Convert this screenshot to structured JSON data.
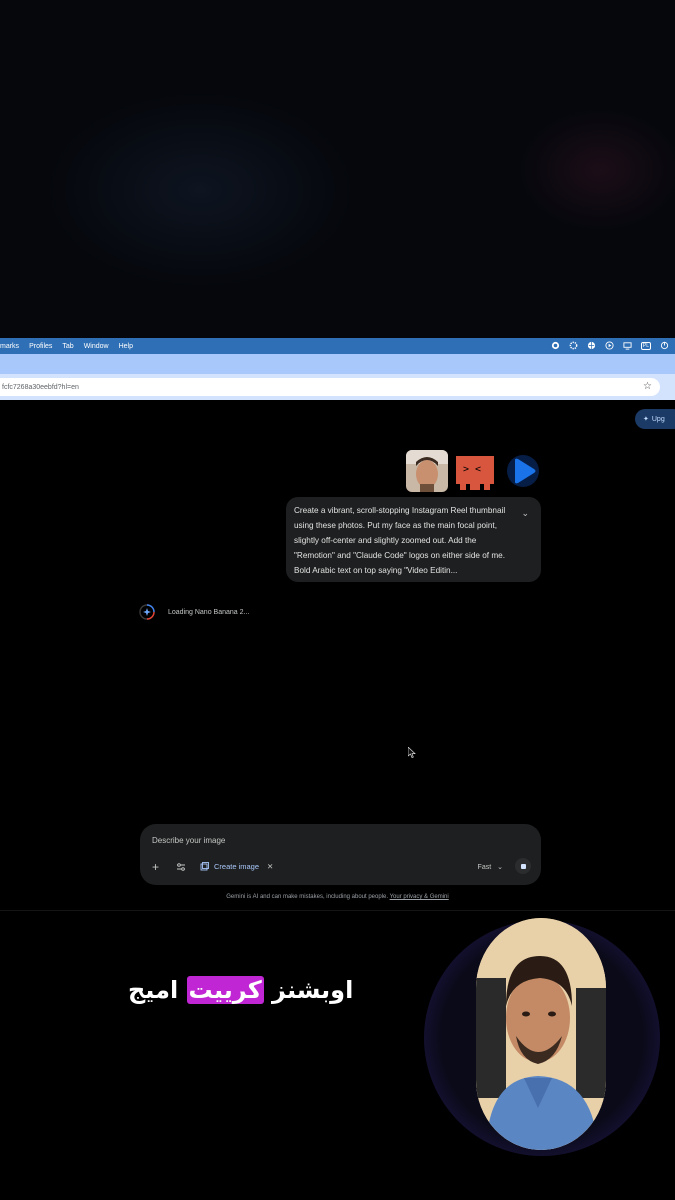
{
  "menubar": {
    "items": [
      "marks",
      "Profiles",
      "Tab",
      "Window",
      "Help"
    ],
    "status_icons": [
      "record-icon",
      "gear-icon",
      "globe-icon",
      "play-icon",
      "display-icon",
      "keyboard-layout-icon",
      "power-icon"
    ],
    "layout_badge": "PL"
  },
  "browser": {
    "url": "fcfc7268a30eebfd?hl=en"
  },
  "gemini": {
    "upgrade_label": "Upg",
    "prompt_text": "Create a vibrant, scroll-stopping Instagram Reel thumbnail using these photos. Put my face as the main focal point, slightly off-center and slightly zoomed out. Add the \"Remotion\" and \"Claude Code\" logos on either side of me. Bold Arabic text on top saying \"Video Editin...",
    "loading_text": "Loading Nano Banana 2...",
    "composer": {
      "placeholder": "Describe your image",
      "chip_label": "Create image",
      "mode_label": "Fast"
    },
    "disclaimer": "Gemini is AI and can make mistakes, including about people.",
    "disclaimer_link": "Your privacy & Gemini"
  },
  "overlay": {
    "caption_before": "اوبشنز ",
    "caption_highlight": "كرييت",
    "caption_after": " اميج",
    "highlight_color": "#c026d3"
  },
  "colors": {
    "menubar": "#2f6fb5",
    "tabstrip": "#a8c7fa",
    "card": "#1e1f20",
    "accent": "#a8c7fa"
  }
}
